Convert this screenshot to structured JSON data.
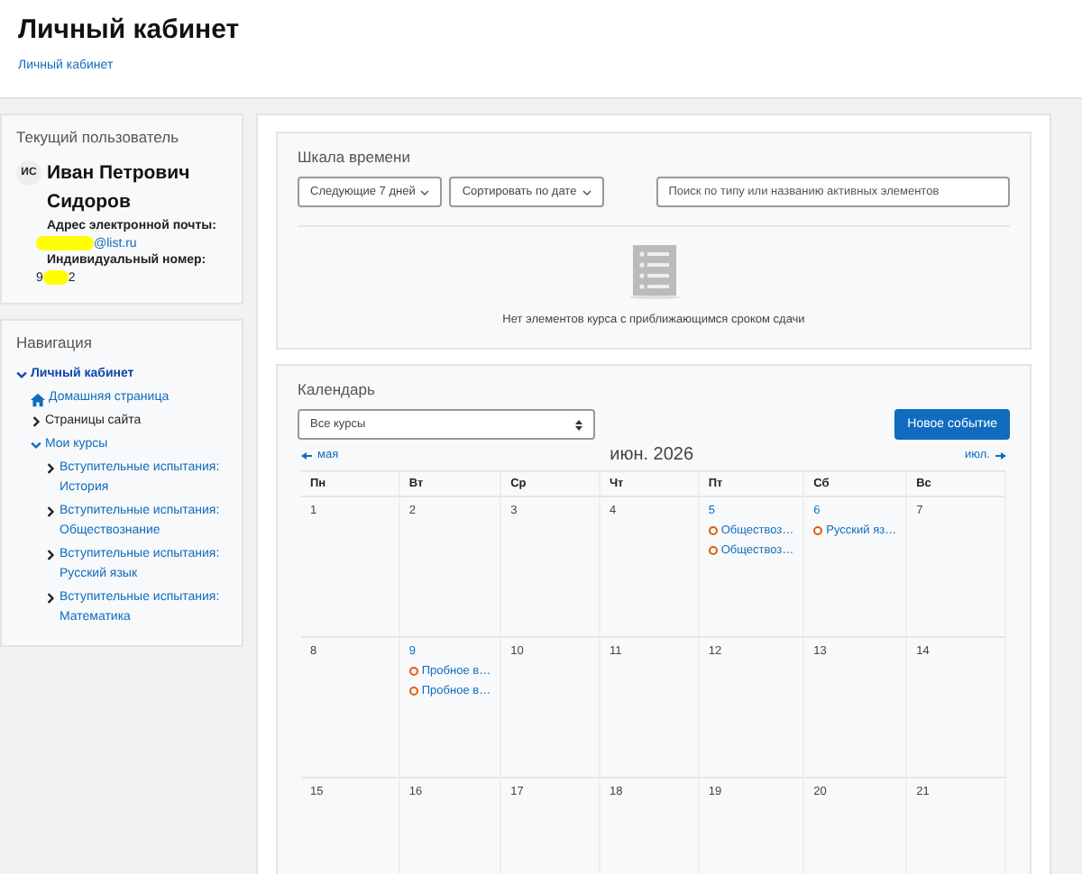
{
  "header": {
    "title": "Личный кабинет",
    "breadcrumb": "Личный кабинет"
  },
  "user_card": {
    "title": "Текущий пользователь",
    "initials": "ИС",
    "name": "Иван Петрович Сидоров",
    "email_label": "Адрес электронной почты:",
    "email_visible_end": "@list.ru",
    "id_label": "Индивидуальный номер:",
    "id_visible_start": "9",
    "id_visible_end": "2"
  },
  "navigation": {
    "title": "Навигация",
    "items": [
      {
        "label": "Личный кабинет",
        "kind": "root",
        "expanded": true,
        "children": [
          {
            "label": "Домашняя страница",
            "kind": "home"
          },
          {
            "label": "Страницы сайта",
            "kind": "branch",
            "expanded": false
          },
          {
            "label": "Мои курсы",
            "kind": "branch",
            "expanded": true,
            "children": [
              {
                "label": "Вступительные испытания: История",
                "kind": "course",
                "expanded": false
              },
              {
                "label": "Вступительные испытания: Обществознание",
                "kind": "course",
                "expanded": false
              },
              {
                "label": "Вступительные испытания: Русский язык",
                "kind": "course",
                "expanded": false
              },
              {
                "label": "Вступительные испытания: Математика",
                "kind": "course",
                "expanded": false
              }
            ]
          }
        ]
      }
    ]
  },
  "timeline": {
    "title": "Шкала времени",
    "filter": "Следующие 7 дней",
    "sort": "Сортировать по дате",
    "search": {
      "placeholder": "Поиск по типу или названию активных элементов"
    },
    "empty_message": "Нет элементов курса с приближающимся сроком сдачи"
  },
  "calendar": {
    "title": "Календарь",
    "course_select": "Все курсы",
    "new_event_button": "Новое событие",
    "prev_month": "мая",
    "month": "июн. 2026",
    "next_month": "июл.",
    "weekdays": [
      "Пн",
      "Вт",
      "Ср",
      "Чт",
      "Пт",
      "Сб",
      "Вс"
    ],
    "weeks": [
      [
        {
          "day": "1"
        },
        {
          "day": "2"
        },
        {
          "day": "3"
        },
        {
          "day": "4"
        },
        {
          "day": "5",
          "events": [
            {
              "title": "Обществоз…",
              "color": "#e8590c"
            },
            {
              "title": "Обществоз…",
              "color": "#e8590c"
            }
          ]
        },
        {
          "day": "6",
          "events": [
            {
              "title": "Русский яз…",
              "color": "#e8590c"
            }
          ]
        },
        {
          "day": "7"
        }
      ],
      [
        {
          "day": "8"
        },
        {
          "day": "9",
          "events": [
            {
              "title": "Пробное в…",
              "color": "#e8590c"
            },
            {
              "title": "Пробное в…",
              "color": "#e8590c"
            }
          ]
        },
        {
          "day": "10"
        },
        {
          "day": "11"
        },
        {
          "day": "12"
        },
        {
          "day": "13"
        },
        {
          "day": "14"
        }
      ],
      [
        {
          "day": "15"
        },
        {
          "day": "16"
        },
        {
          "day": "17"
        },
        {
          "day": "18"
        },
        {
          "day": "19"
        },
        {
          "day": "20"
        },
        {
          "day": "21"
        }
      ]
    ]
  }
}
